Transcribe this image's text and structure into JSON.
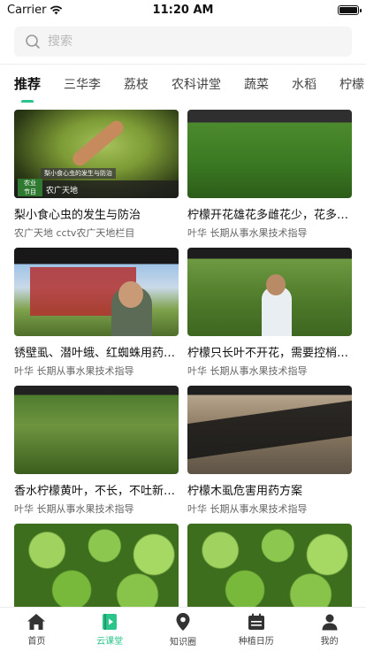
{
  "status_bar": {
    "carrier": "Carrier",
    "time": "11:20 AM"
  },
  "search": {
    "placeholder": "搜索"
  },
  "tabs": [
    {
      "label": "推荐",
      "active": true
    },
    {
      "label": "三华李"
    },
    {
      "label": "荔枝"
    },
    {
      "label": "农科讲堂"
    },
    {
      "label": "蔬菜"
    },
    {
      "label": "水稻"
    },
    {
      "label": "柠檬"
    }
  ],
  "cards": [
    {
      "title": "梨小食心虫的发生与防治",
      "subtitle": "农广天地 cctv农广天地栏目",
      "overlay_caption": "梨小食心虫的发生与防治",
      "overlay_banner": "农广天地",
      "overlay_logo": "农业\n节目"
    },
    {
      "title": "柠檬开花雄花多雌花少，花多没果现象该怎么办",
      "subtitle": "叶华 长期从事水果技术指导"
    },
    {
      "title": "锈壁虱、潜叶蛾、红蜘蛛用药方法",
      "subtitle": "叶华 长期从事水果技术指导"
    },
    {
      "title": "柠檬只长叶不开花，需要控梢促花",
      "subtitle": "叶华 长期从事水果技术指导"
    },
    {
      "title": "香水柠檬黄叶，不长，不吐新梢用药方法",
      "subtitle": "叶华 长期从事水果技术指导"
    },
    {
      "title": "柠檬木虱危害用药方案",
      "subtitle": "叶华 长期从事水果技术指导"
    },
    {
      "title": "",
      "subtitle": ""
    },
    {
      "title": "",
      "subtitle": ""
    }
  ],
  "bottom_nav": [
    {
      "label": "首页",
      "icon": "home-icon",
      "active": false
    },
    {
      "label": "云课堂",
      "icon": "video-book-icon",
      "active": true
    },
    {
      "label": "知识圈",
      "icon": "location-pin-icon",
      "active": false
    },
    {
      "label": "种植日历",
      "icon": "calendar-icon",
      "active": false
    },
    {
      "label": "我的",
      "icon": "person-icon",
      "active": false
    }
  ],
  "colors": {
    "accent": "#2bc48a",
    "icon_dark": "#333333"
  }
}
